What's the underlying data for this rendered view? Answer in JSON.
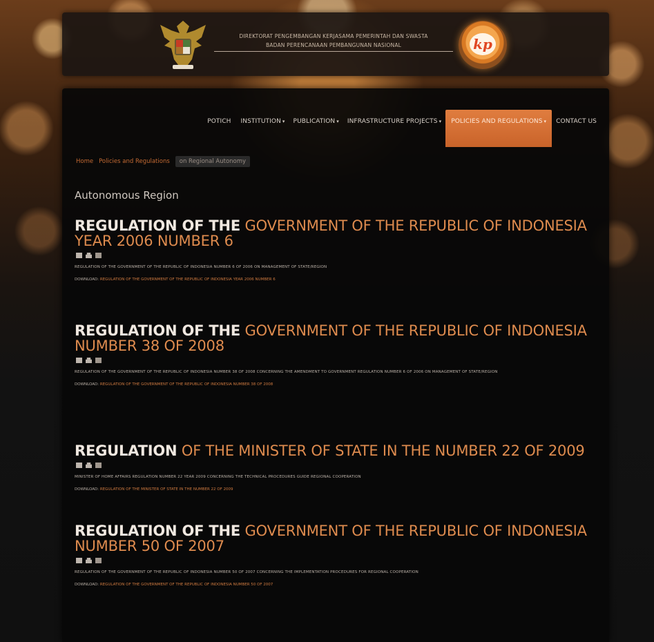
{
  "header": {
    "line1": "DIREKTORAT PENGEMBANGAN KERJASAMA PEMERINTAH DAN SWASTA",
    "line2": "BADAN PERENCANAAN PEMBANGUNAN NASIONAL",
    "logo_text": "kp"
  },
  "nav": {
    "items": [
      {
        "label": "POTICH",
        "caret": ""
      },
      {
        "label": "INSTITUTION",
        "caret": "▾"
      },
      {
        "label": "PUBLICATION",
        "caret": "▾"
      },
      {
        "label": "INFRASTRUCTURE PROJECTS",
        "caret": "▾"
      },
      {
        "label": "POLICIES AND REGULATIONS",
        "caret": "▾"
      },
      {
        "label": "CONTACT US",
        "caret": ""
      }
    ]
  },
  "breadcrumb": {
    "home": "Home",
    "policies": "Policies and Regulations",
    "current": "on Regional Autonomy"
  },
  "section_title": "Autonomous Region",
  "entries": [
    {
      "title_hl": "REGULATION OF THE",
      "title_rest": "GOVERNMENT OF THE REPUBLIC OF INDONESIA YEAR 2006 NUMBER 6",
      "description": "REGULATION OF THE GOVERNMENT OF THE REPUBLIC OF INDONESIA NUMBER 6 OF 2006 ON MANAGEMENT OF STATE/REGION",
      "download_label": "Download:",
      "download_link": "REGULATION OF THE GOVERNMENT OF THE REPUBLIC OF INDONESIA YEAR 2006 NUMBER 6"
    },
    {
      "title_hl": "REGULATION OF THE",
      "title_rest": "GOVERNMENT OF THE REPUBLIC OF INDONESIA NUMBER 38 OF 2008",
      "description": "REGULATION OF THE GOVERNMENT OF THE REPUBLIC OF INDONESIA NUMBER 38 OF 2008 CONCERNING THE AMENDMENT TO GOVERNMENT REGULATION NUMBER 6 OF 2006 ON MANAGEMENT OF STATE/REGION",
      "download_label": "Download:",
      "download_link": "REGULATION OF THE GOVERNMENT OF THE REPUBLIC OF INDONESIA NUMBER 38 OF 2008"
    },
    {
      "title_hl": "REGULATION",
      "title_rest": "OF THE MINISTER OF STATE IN THE NUMBER 22 OF 2009",
      "description": "MINISTER OF HOME AFFAIRS REGULATION NUMBER 22 YEAR 2009 CONCERNING THE TECHNICAL PROCEDURES GUIDE REGIONAL COOPERATION",
      "download_label": "Download:",
      "download_link": "REGULATION OF THE MINISTER OF STATE IN THE NUMBER 22 OF 2009"
    },
    {
      "title_hl": "REGULATION OF THE",
      "title_rest": "GOVERNMENT OF THE REPUBLIC OF INDONESIA NUMBER 50 OF 2007",
      "description": "REGULATION OF THE GOVERNMENT OF THE REPUBLIC OF INDONESIA NUMBER 50 OF 2007 CONCERNING THE IMPLEMENTATION PROCEDURES FOR REGIONAL COOPERATION",
      "download_label": "Download:",
      "download_link": "REGULATION OF THE GOVERNMENT OF THE REPUBLIC OF INDONESIA NUMBER 50 OF 2007"
    }
  ],
  "icons": [
    "pdf-icon",
    "print-icon",
    "email-icon"
  ],
  "colors": {
    "accent": "#de8b4e",
    "nav_active": "#d8703a",
    "link": "#cf7a40",
    "content_bg": "#080808"
  }
}
